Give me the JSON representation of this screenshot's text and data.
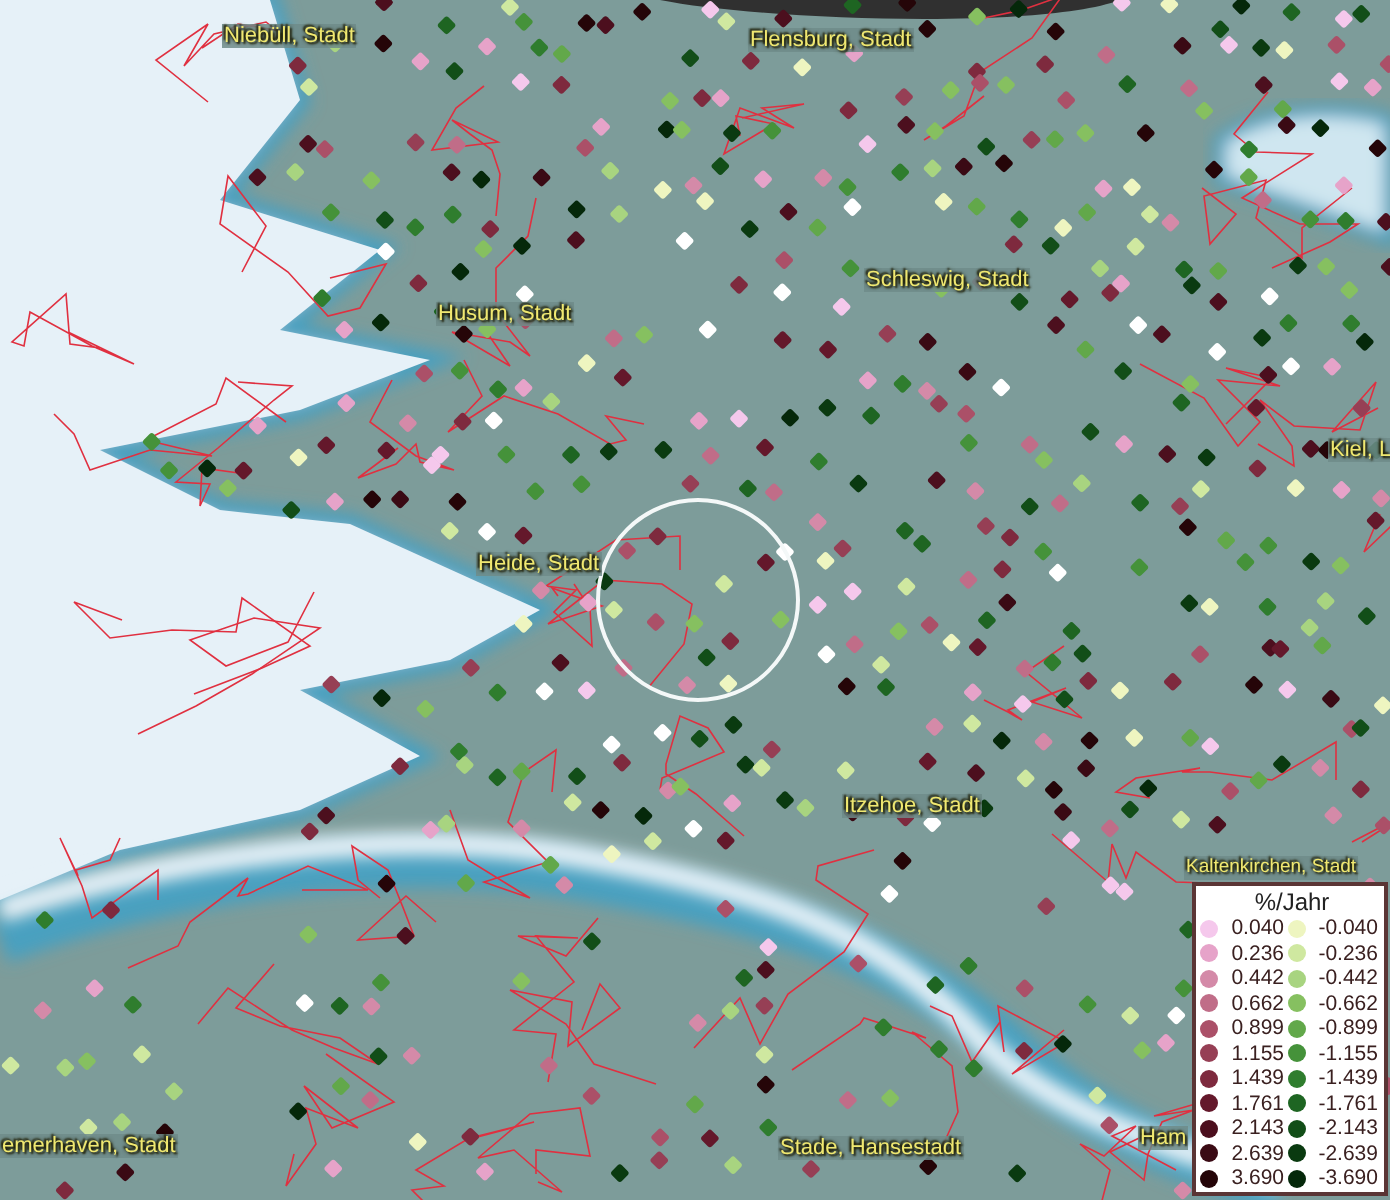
{
  "map": {
    "places": [
      {
        "name": "Niebüll, Stadt"
      },
      {
        "name": "Flensburg, Stadt"
      },
      {
        "name": "Schleswig, Stadt"
      },
      {
        "name": "Husum, Stadt"
      },
      {
        "name": "Kiel, L"
      },
      {
        "name": "Heide, Stadt"
      },
      {
        "name": "Itzehoe, Stadt"
      },
      {
        "name": "Kaltenkirchen, Stadt"
      },
      {
        "name": "emerhaven, Stadt"
      },
      {
        "name": "Stade, Hansestadt"
      },
      {
        "name": "Ham"
      }
    ]
  },
  "legend": {
    "title": "%/Jahr",
    "rows": [
      {
        "positive": {
          "label": "0.040",
          "color": "#f5c8ec"
        },
        "negative": {
          "label": "-0.040",
          "color": "#eef5c0"
        }
      },
      {
        "positive": {
          "label": "0.236",
          "color": "#e6a3c9"
        },
        "negative": {
          "label": "-0.236",
          "color": "#cfe8a0"
        }
      },
      {
        "positive": {
          "label": "0.442",
          "color": "#d48aa8"
        },
        "negative": {
          "label": "-0.442",
          "color": "#a8d480"
        }
      },
      {
        "positive": {
          "label": "0.662",
          "color": "#c06d88"
        },
        "negative": {
          "label": "-0.662",
          "color": "#86c060"
        }
      },
      {
        "positive": {
          "label": "0.899",
          "color": "#ab5068"
        },
        "negative": {
          "label": "-0.899",
          "color": "#62a84a"
        }
      },
      {
        "positive": {
          "label": "1.155",
          "color": "#963f55"
        },
        "negative": {
          "label": "-1.155",
          "color": "#45923a"
        }
      },
      {
        "positive": {
          "label": "1.439",
          "color": "#7e2a3e"
        },
        "negative": {
          "label": "-1.439",
          "color": "#2f7d2e"
        }
      },
      {
        "positive": {
          "label": "1.761",
          "color": "#64182b"
        },
        "negative": {
          "label": "-1.761",
          "color": "#1e6522"
        }
      },
      {
        "positive": {
          "label": "2.143",
          "color": "#4c0f1e"
        },
        "negative": {
          "label": "-2.143",
          "color": "#124e18"
        }
      },
      {
        "positive": {
          "label": "2.639",
          "color": "#3a0a14"
        },
        "negative": {
          "label": "-2.639",
          "color": "#0a3a10"
        }
      },
      {
        "positive": {
          "label": "3.690",
          "color": "#250508"
        },
        "negative": {
          "label": "-3.690",
          "color": "#05280a"
        }
      }
    ]
  }
}
